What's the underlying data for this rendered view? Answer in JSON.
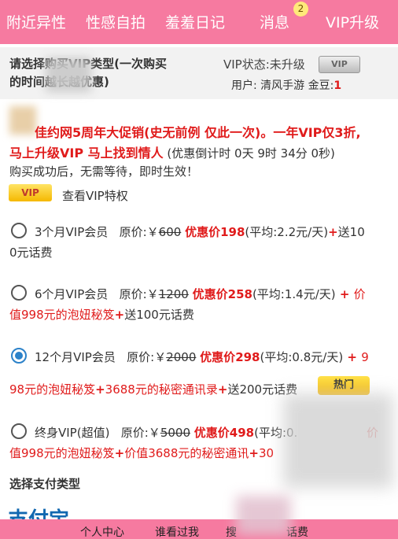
{
  "topnav": {
    "tabs": [
      "附近异性",
      "性感自拍",
      "羞羞日记",
      "消息",
      "VIP升级"
    ],
    "message_badge": "2"
  },
  "header": {
    "req_line1": "请选择购买VIP类型(一次购买",
    "req_line2": "的时间越长越优惠)",
    "vip_status_label": "VIP状态:",
    "vip_status_value": "未升级",
    "vip_tag": "VIP",
    "user_label": "用户: ",
    "user_name": "清风手游",
    "beans_label": " 金豆:",
    "beans_value": "1"
  },
  "promo": {
    "line1": "佳约网5周年大促销(史无前例 仅此一次)。一年VIP仅3折,",
    "line2_bold": "马上升级VIP 马上找到情人",
    "line2_countdown": " (优惠倒计时 0天 9时 34分 0秒)",
    "line3": "购买成功后，无需等待，即时生效！",
    "vip_badge": "VIP",
    "view_vip": "查看VIP特权"
  },
  "options": [
    {
      "name": "3个月VIP会员",
      "orig_label": "原价:￥",
      "orig_price": "600",
      "disc_label": "优惠价",
      "disc_price": "198",
      "avg": "(平均:2.2元/天)",
      "extra1": "+",
      "extra1_text": "送10",
      "line2": "0元话费",
      "selected": false
    },
    {
      "name": "6个月VIP会员",
      "orig_label": "原价:￥",
      "orig_price": "1200",
      "disc_label": "优惠价",
      "disc_price": "258",
      "avg": "(平均:1.4元/天)",
      "extra1": " + ",
      "extra1_text": "价",
      "line2_red": "值998元的泡妞秘笈",
      "line2_plus": "+",
      "line2_rest": "送100元话费",
      "selected": false
    },
    {
      "name": "12个月VIP会员",
      "orig_label": "原价:￥",
      "orig_price": "2000",
      "disc_label": "优惠价",
      "disc_price": "298",
      "avg": "(平均:0.8元/天)",
      "extra1": " + ",
      "extra1_text": "9",
      "line2_red": "98元的泡妞秘笈",
      "line2_plus": "+",
      "line2_mid": "3688元的秘密通讯录",
      "line2_plus2": "+",
      "line2_rest": "送200元话费",
      "hot": "热门",
      "selected": true
    },
    {
      "name": "终身VIP(超值)",
      "orig_label": "原价:￥",
      "orig_price": "5000",
      "disc_label": "优惠价",
      "disc_price": "498",
      "avg": "(平均:0.",
      "extra1_text": "价",
      "line2_red": "值998元的泡妞秘笈",
      "line2_plus": "+",
      "line2_mid": "价值3688元的秘密通讯",
      "line2_plus2": "+",
      "line2_rest": "30",
      "selected": false
    }
  ],
  "payment": {
    "title": "选择支付类型",
    "alipay": "支付宝"
  },
  "bottomnav": {
    "items": [
      "个人中心",
      "谁看过我",
      "搜",
      "话费"
    ]
  }
}
